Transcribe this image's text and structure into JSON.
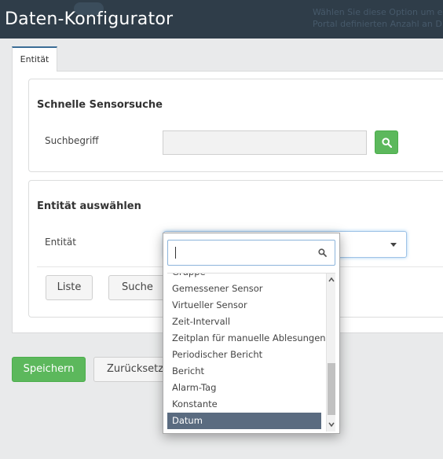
{
  "header": {
    "title": "Daten-Konfigurator",
    "hint_line1": "Wählen Sie diese Option um e",
    "hint_line2": "Portal definierten Anzahl an D"
  },
  "tabs": [
    {
      "label": "Entität"
    }
  ],
  "quick_search": {
    "title": "Schnelle Sensorsuche",
    "label": "Suchbegriff",
    "value": "",
    "placeholder": ""
  },
  "entity_select": {
    "title": "Entität auswählen",
    "label": "Entität",
    "value": ""
  },
  "buttons": {
    "liste": "Liste",
    "suche": "Suche",
    "save": "Speichern",
    "reset": "Zurücksetzen"
  },
  "dropdown": {
    "search_value": "",
    "items": [
      "Gruppe",
      "Gemessener Sensor",
      "Virtueller Sensor",
      "Zeit-Intervall",
      "Zeitplan für manuelle Ablesungen",
      "Periodischer Bericht",
      "Bericht",
      "Alarm-Tag",
      "Konstante",
      "Datum"
    ],
    "highlighted": "Datum"
  },
  "colors": {
    "header_bg": "#2f3d49",
    "success": "#5cb85c",
    "highlight": "#5a6b80"
  }
}
